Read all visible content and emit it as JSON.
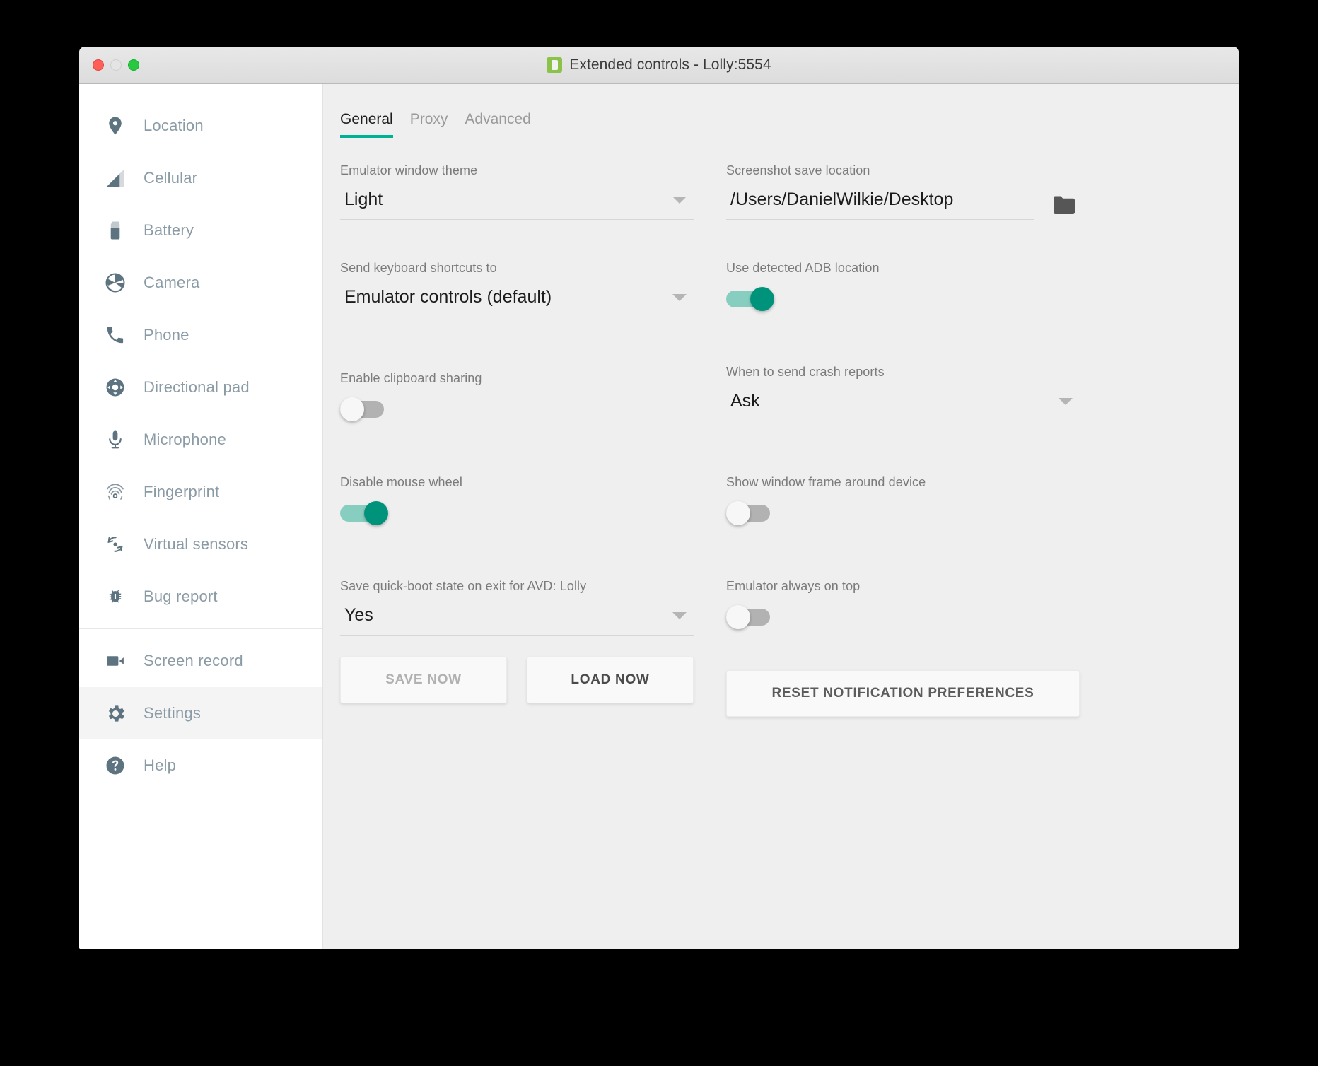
{
  "window": {
    "title": "Extended controls - Lolly:5554",
    "app_icon": "android-emulator-icon",
    "controls": {
      "close": "close-button",
      "minimize": "minimize-button",
      "zoom": "zoom-button"
    }
  },
  "sidebar": {
    "items": [
      {
        "label": "Location",
        "icon": "location-pin-icon",
        "selected": false
      },
      {
        "label": "Cellular",
        "icon": "signal-bars-icon",
        "selected": false
      },
      {
        "label": "Battery",
        "icon": "battery-icon",
        "selected": false
      },
      {
        "label": "Camera",
        "icon": "camera-aperture-icon",
        "selected": false
      },
      {
        "label": "Phone",
        "icon": "phone-handset-icon",
        "selected": false
      },
      {
        "label": "Directional pad",
        "icon": "dpad-icon",
        "selected": false
      },
      {
        "label": "Microphone",
        "icon": "microphone-icon",
        "selected": false
      },
      {
        "label": "Fingerprint",
        "icon": "fingerprint-icon",
        "selected": false
      },
      {
        "label": "Virtual sensors",
        "icon": "rotation-sensor-icon",
        "selected": false
      },
      {
        "label": "Bug report",
        "icon": "bug-icon",
        "selected": false
      },
      {
        "label": "Screen record",
        "icon": "video-camera-icon",
        "selected": false
      },
      {
        "label": "Settings",
        "icon": "gear-icon",
        "selected": true
      },
      {
        "label": "Help",
        "icon": "question-circle-icon",
        "selected": false
      }
    ],
    "divider_after_index": 9
  },
  "tabs": [
    {
      "label": "General",
      "active": true
    },
    {
      "label": "Proxy",
      "active": false
    },
    {
      "label": "Advanced",
      "active": false
    }
  ],
  "left_column": {
    "theme": {
      "label": "Emulator window theme",
      "value": "Light"
    },
    "keyboard": {
      "label": "Send keyboard shortcuts to",
      "value": "Emulator controls (default)"
    },
    "clipboard": {
      "label": "Enable clipboard sharing",
      "state": "off"
    },
    "mouse_wheel": {
      "label": "Disable mouse wheel",
      "state": "on"
    },
    "quick_boot": {
      "label": "Save quick-boot state on exit for AVD: Lolly",
      "value": "Yes"
    },
    "save_now_label": "SAVE NOW",
    "load_now_label": "LOAD NOW"
  },
  "right_column": {
    "screenshot": {
      "label": "Screenshot save location",
      "value": "/Users/DanielWilkie/Desktop",
      "browse_icon": "folder-icon"
    },
    "adb": {
      "label": "Use detected ADB location",
      "state": "on"
    },
    "crash_reports": {
      "label": "When to send crash reports",
      "value": "Ask"
    },
    "window_frame": {
      "label": "Show window frame around device",
      "state": "off"
    },
    "always_on_top": {
      "label": "Emulator always on top",
      "state": "off"
    },
    "reset_label": "RESET NOTIFICATION PREFERENCES"
  },
  "colors": {
    "accent_teal": "#00b294",
    "toggle_on_knob": "#00937c",
    "toggle_on_track": "#88cec0",
    "toggle_off_track": "#b2b2b2",
    "sidebar_text": "#8b9ba6",
    "content_bg": "#efefef"
  }
}
